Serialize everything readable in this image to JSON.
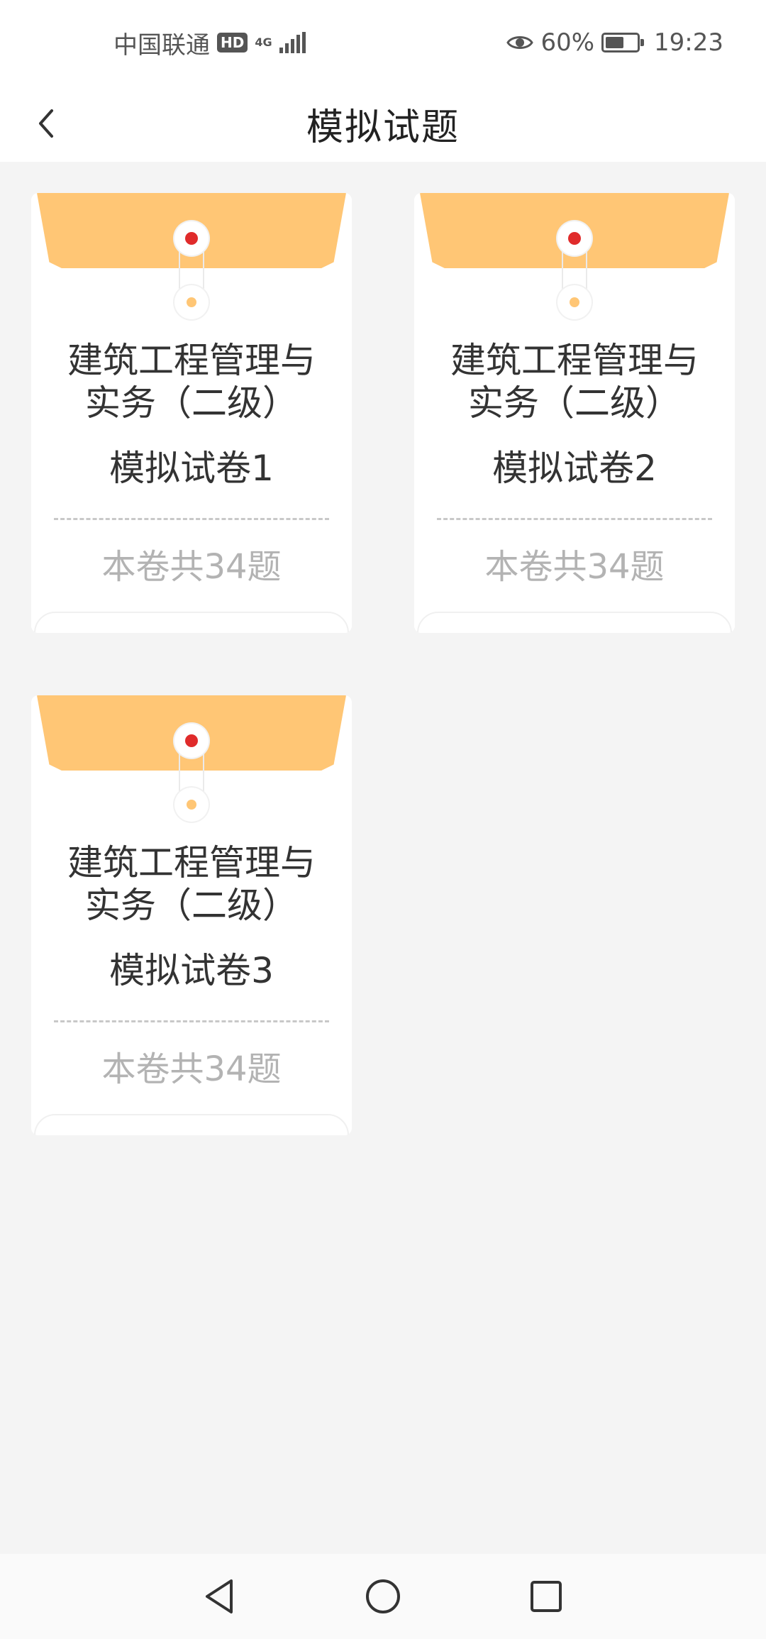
{
  "status_bar": {
    "carrier": "中国联通",
    "hd": "HD",
    "network": "4G",
    "battery_text": "60%",
    "battery_level": 0.6,
    "time": "19:23"
  },
  "header": {
    "title": "模拟试题"
  },
  "cards": [
    {
      "title_line1": "建筑工程管理与",
      "title_line2": "实务（二级）",
      "paper": "模拟试卷1",
      "count": "本卷共34题"
    },
    {
      "title_line1": "建筑工程管理与",
      "title_line2": "实务（二级）",
      "paper": "模拟试卷2",
      "count": "本卷共34题"
    },
    {
      "title_line1": "建筑工程管理与",
      "title_line2": "实务（二级）",
      "paper": "模拟试卷3",
      "count": "本卷共34题"
    }
  ],
  "colors": {
    "flap": "#ffc675",
    "button_dot": "#e02b2b",
    "count_text": "#b3b3b3"
  }
}
